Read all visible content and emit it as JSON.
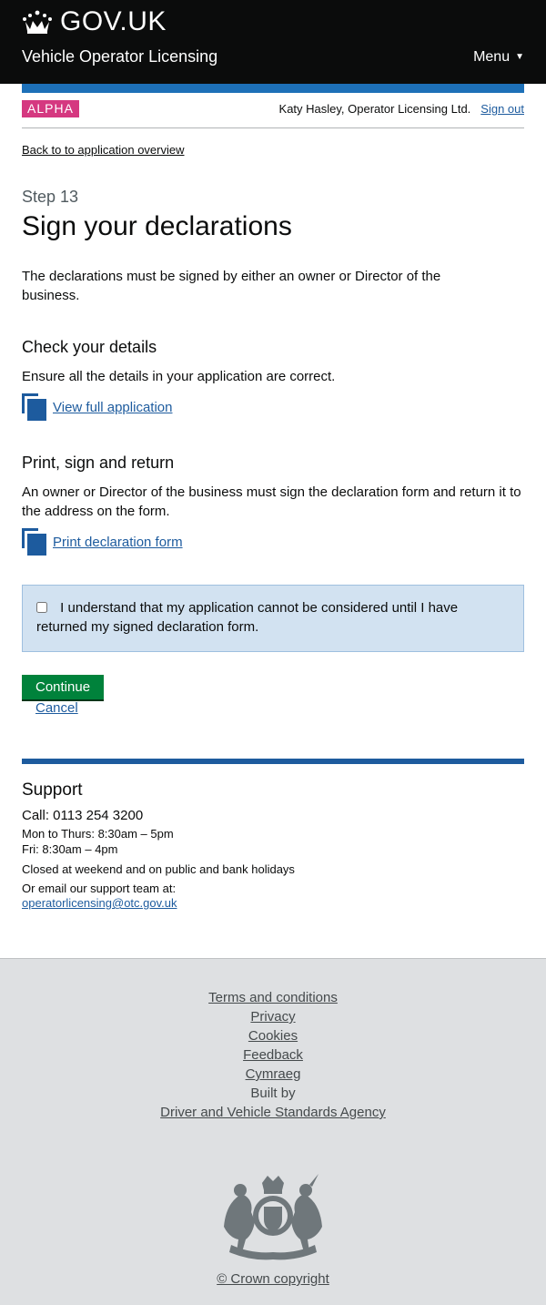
{
  "header": {
    "brand": "GOV.UK",
    "service_name": "Vehicle Operator Licensing",
    "menu_label": "Menu",
    "crown_icon": "crown-icon"
  },
  "phase": {
    "tag": "ALPHA",
    "user_name": "Katy Hasley, Operator Licensing Ltd.",
    "sign_out": "Sign out"
  },
  "main": {
    "back_link": "Back to to application overview",
    "caption": "Step 13",
    "title": "Sign your declarations",
    "intro": "The declarations must be signed by either an owner or Director of the business.",
    "check": {
      "heading": "Check your details",
      "text": "Ensure all the details in your application are correct.",
      "link": "View full application"
    },
    "print": {
      "heading": "Print, sign and return",
      "text": "An owner or Director of the business must sign the declaration form and return it to the address on the form.",
      "link": "Print declaration form"
    },
    "confirm_text": "I understand that my application cannot be considered until I have returned my signed declaration form.",
    "confirm_checked": false,
    "continue_label": "Continue",
    "cancel_label": "Cancel"
  },
  "support": {
    "heading": "Support",
    "call": "Call: 0113 254 3200",
    "hours_mon_thu": "Mon to Thurs: 8:30am – 5pm",
    "hours_fri": "Fri: 8:30am – 4pm",
    "closed": "Closed at weekend and on public and bank holidays",
    "email_intro": "Or email our support team at:",
    "email": "operatorlicensing@otc.gov.uk"
  },
  "footer": {
    "links": [
      "Terms and conditions",
      "Privacy",
      "Cookies",
      "Feedback",
      "Cymraeg"
    ],
    "built_by_prefix": "Built by",
    "built_by_link": "Driver and Vehicle Standards Agency",
    "copyright": "© Crown copyright",
    "crest_icon": "royal-coat-of-arms-icon"
  },
  "colors": {
    "header_bg": "#0b0c0c",
    "accent_blue": "#1d70b8",
    "phase_tag": "#d53880",
    "continue_green": "#00823b",
    "confirm_bg": "#d2e2f1",
    "footer_bg": "#dee0e2"
  }
}
